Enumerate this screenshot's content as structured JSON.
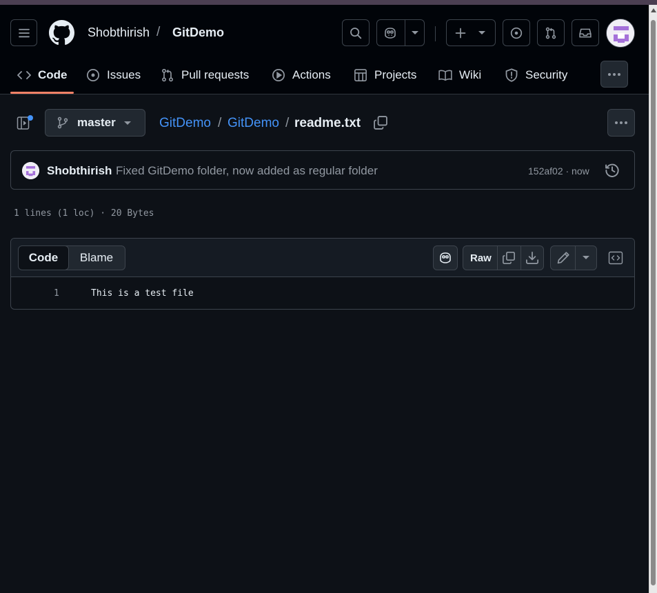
{
  "header": {
    "owner": "Shobthirish",
    "separator": "/",
    "repo": "GitDemo",
    "icons": [
      "menu-icon",
      "github-logo",
      "search-icon",
      "copilot-icon",
      "plus-icon",
      "issue-icon",
      "pull-request-icon",
      "inbox-icon"
    ]
  },
  "tabs": [
    {
      "label": "Code",
      "icon": "code-icon",
      "active": true
    },
    {
      "label": "Issues",
      "icon": "issue-icon"
    },
    {
      "label": "Pull requests",
      "icon": "pull-request-icon"
    },
    {
      "label": "Actions",
      "icon": "play-icon"
    },
    {
      "label": "Projects",
      "icon": "table-icon"
    },
    {
      "label": "Wiki",
      "icon": "book-icon"
    },
    {
      "label": "Security",
      "icon": "shield-icon"
    }
  ],
  "file_nav": {
    "branch": "master",
    "breadcrumb": {
      "root": "GitDemo",
      "sep": "/",
      "folder": "GitDemo",
      "file": "readme.txt"
    }
  },
  "commit": {
    "author": "Shobthirish",
    "message": "Fixed GitDemo folder, now added as regular folder",
    "sha_time": "152af02 · now"
  },
  "file_meta": "1 lines (1 loc) · 20 Bytes",
  "viewer": {
    "tabs": {
      "code": "Code",
      "blame": "Blame"
    },
    "raw_label": "Raw",
    "lines": [
      {
        "number": "1",
        "text": "This is a test file"
      }
    ]
  },
  "colors": {
    "accent_underline": "#f78166",
    "link": "#4493f8",
    "bg": "#0d1117",
    "header_bg": "#010409"
  }
}
